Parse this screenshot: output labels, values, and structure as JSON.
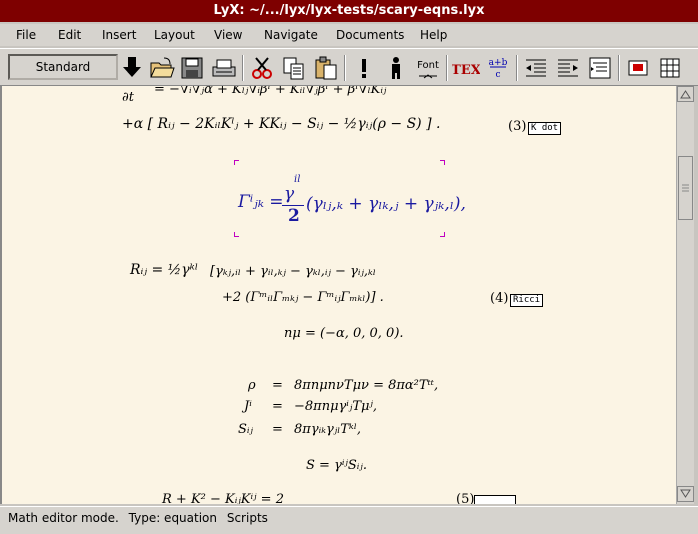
{
  "window": {
    "title": "LyX: ~/.../lyx/lyx-tests/scary-eqns.lyx"
  },
  "menu": [
    {
      "label": "File"
    },
    {
      "label": "Edit"
    },
    {
      "label": "Insert"
    },
    {
      "label": "Layout"
    },
    {
      "label": "View"
    },
    {
      "label": "Navigate"
    },
    {
      "label": "Documents"
    },
    {
      "label": "Help"
    }
  ],
  "toolbar": {
    "layout_value": "Standard",
    "font_label": "Font",
    "tex_label": "TEX",
    "math_label": "a+b"
  },
  "document": {
    "eq_partial": "∂t",
    "eq_top": "= −∇ᵢ∇ⱼα + Kₗⱼ∇ᵢβˡ + Kᵢₗ∇ⱼβˡ + βˡ∇ₗKᵢⱼ",
    "eq_line2": "+α [ Rᵢⱼ − 2KᵢₗKˡⱼ + KKᵢⱼ − Sᵢⱼ − ½γᵢⱼ(ρ − S) ] .",
    "eq3_number": "(3)",
    "eq3_label": "K dot",
    "christoffel_lhs": "Γⁱⱼₖ =",
    "christoffel_num": "γ",
    "christoffel_sup": "il",
    "christoffel_den": "2",
    "christoffel_rhs": "(γₗⱼ,ₖ + γₗₖ,ⱼ + γⱼₖ,ₗ),",
    "ricci_lhs": "Rᵢⱼ = ½γᵏˡ",
    "ricci_line1": "[γₖⱼ,ᵢₗ + γᵢₗ,ₖⱼ − γₖₗ,ᵢⱼ − γᵢⱼ,ₖₗ",
    "ricci_line2": "+2 (ΓᵐᵢₗΓₘₖⱼ − ΓᵐᵢⱼΓₘₖₗ)] .",
    "eq4_number": "(4)",
    "eq4_label": "Ricci",
    "normal": "nμ = (−α, 0, 0, 0).",
    "rho_lhs": "ρ",
    "rho_rhs": "8πnμnνTμν = 8πα²Tᵗᵗ,",
    "j_lhs": "Jⁱ",
    "j_rhs": "−8πnμγⁱⱼTμʲ,",
    "s_lhs": "Sᵢⱼ",
    "s_rhs": "8πγᵢₖγⱼₗTᵏˡ,",
    "eq_sign": "=",
    "trace": "S = γⁱʲSᵢⱼ.",
    "partial_bottom": "R + K² − KᵢⱼKⁱʲ = 2",
    "eq5_number": "(5)"
  },
  "statusbar": {
    "mode": "Math editor mode.",
    "type": "Type: equation",
    "scripts": "Scripts"
  }
}
